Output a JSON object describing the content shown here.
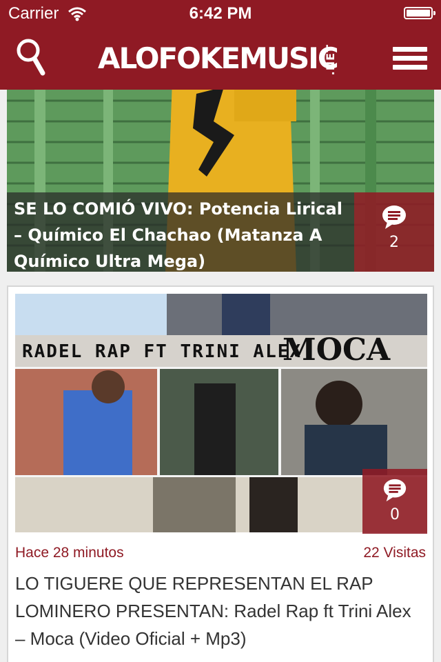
{
  "status_bar": {
    "carrier": "Carrier",
    "time": "6:42 PM"
  },
  "header": {
    "logo_main": "ALOFOKEMUSIC",
    "logo_suffix": ".NET",
    "brand_color": "#8f1a24",
    "search_icon": "search-icon",
    "menu_icon": "hamburger-menu-icon"
  },
  "posts": [
    {
      "title": "SE LO COMIÓ VIVO: Potencia Lirical – Químico El Chachao (Matanza A Químico Ultra Mega)",
      "comments": "2"
    },
    {
      "thumbnail_text_left": "RADEL RAP FT TRINI ALEX",
      "thumbnail_text_right": "MOCA",
      "comments": "0",
      "time": "Hace 28 minutos",
      "visits": "22 Visitas",
      "title": "LO TIGUERE QUE REPRESENTAN EL RAP LOMINERO PRESENTAN: Radel Rap ft Trini Alex – Moca (Video Oficial + Mp3)"
    }
  ]
}
